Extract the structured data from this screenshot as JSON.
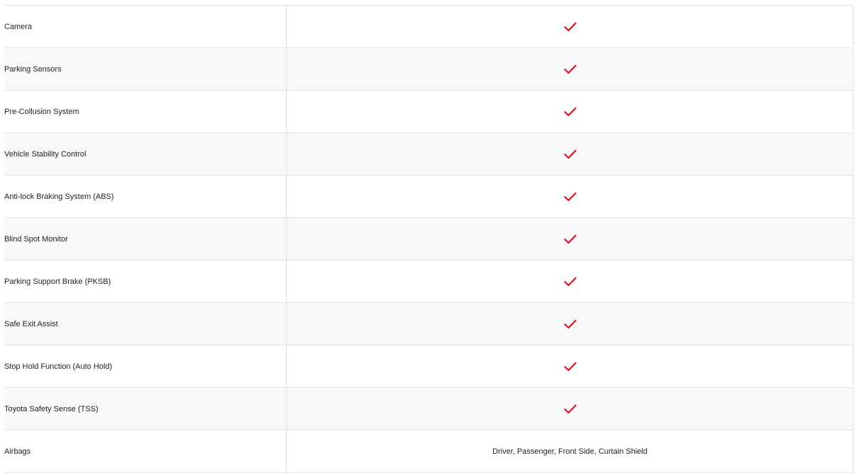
{
  "theme": {
    "check_color": "#e0101e",
    "alt_row_bg": "#f8f8f8",
    "border_color": "#e2e2e2"
  },
  "rows": [
    {
      "label": "Camera",
      "value_type": "check",
      "icon": "check-icon"
    },
    {
      "label": "Parking Sensors",
      "value_type": "check",
      "icon": "check-icon"
    },
    {
      "label": "Pre-Collusion System",
      "value_type": "check",
      "icon": "check-icon"
    },
    {
      "label": "Vehicle Stability Control",
      "value_type": "check",
      "icon": "check-icon"
    },
    {
      "label": "Anti-lock Braking System (ABS)",
      "value_type": "check",
      "icon": "check-icon"
    },
    {
      "label": "Blind Spot Monitor",
      "value_type": "check",
      "icon": "check-icon"
    },
    {
      "label": "Parking Support Brake (PKSB)",
      "value_type": "check",
      "icon": "check-icon"
    },
    {
      "label": "Safe Exit Assist",
      "value_type": "check",
      "icon": "check-icon"
    },
    {
      "label": "Stop Hold Function (Auto Hold)",
      "value_type": "check",
      "icon": "check-icon"
    },
    {
      "label": "Toyota Safety Sense (TSS)",
      "value_type": "check",
      "icon": "check-icon"
    },
    {
      "label": "Airbags",
      "value_type": "text",
      "value": "Driver, Passenger, Front Side, Curtain Shield"
    }
  ]
}
